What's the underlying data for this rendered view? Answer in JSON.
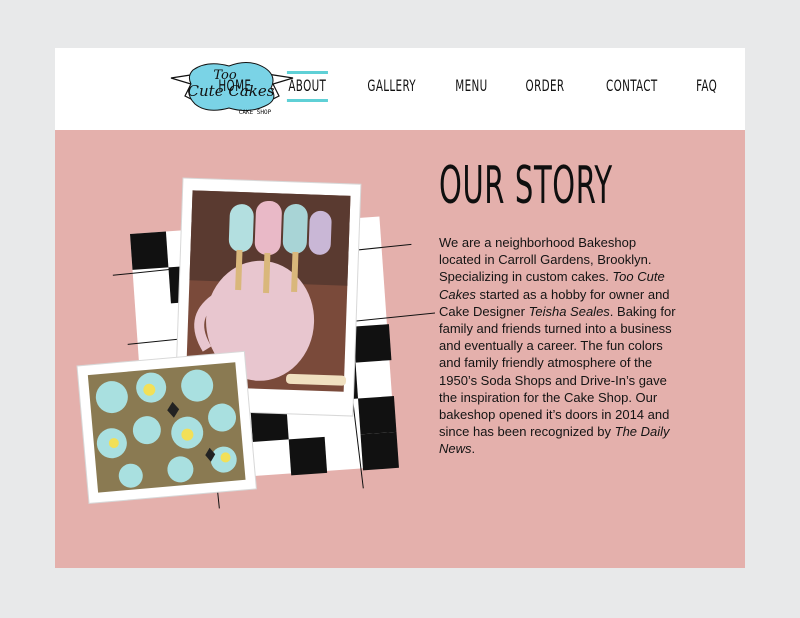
{
  "brand": {
    "name": "Too Cute Cakes",
    "tagline": "CAKE SHOP",
    "logo_word1": "Too",
    "logo_word2": "Cute Cakes"
  },
  "nav": {
    "items": [
      {
        "label": "HOME",
        "active": false
      },
      {
        "label": "ABOUT",
        "active": true
      },
      {
        "label": "GALLERY",
        "active": false
      },
      {
        "label": "MENU",
        "active": false
      },
      {
        "label": "ORDER",
        "active": false
      },
      {
        "label": "CONTACT",
        "active": false
      },
      {
        "label": "FAQ",
        "active": false
      }
    ]
  },
  "page": {
    "title": "OUR STORY",
    "body": [
      {
        "text": "We are a neighborhood Bakeshop located in Carroll Gardens, Brooklyn. Specializing in custom cakes. ",
        "italic": false
      },
      {
        "text": "Too Cute Cakes",
        "italic": true
      },
      {
        "text": " started as a hobby for owner and Cake Designer ",
        "italic": false
      },
      {
        "text": "Teisha Seales",
        "italic": true
      },
      {
        "text": ". Baking for family and friends turned into a business and eventually a career. The fun colors and family friendly atmosphere of the 1950’s Soda Shops and Drive-In’s gave the inspiration for the Cake Shop. Our bakeshop opened it’s doors in 2014 and since has been recognized by ",
        "italic": false
      },
      {
        "text": "The Daily News",
        "italic": true
      },
      {
        "text": ".",
        "italic": false
      }
    ]
  },
  "colors": {
    "background": "#e8e9ea",
    "content_bg": "#e4b0ac",
    "header_bg": "#ffffff",
    "accent": "#5fd0d6",
    "text": "#141414"
  }
}
